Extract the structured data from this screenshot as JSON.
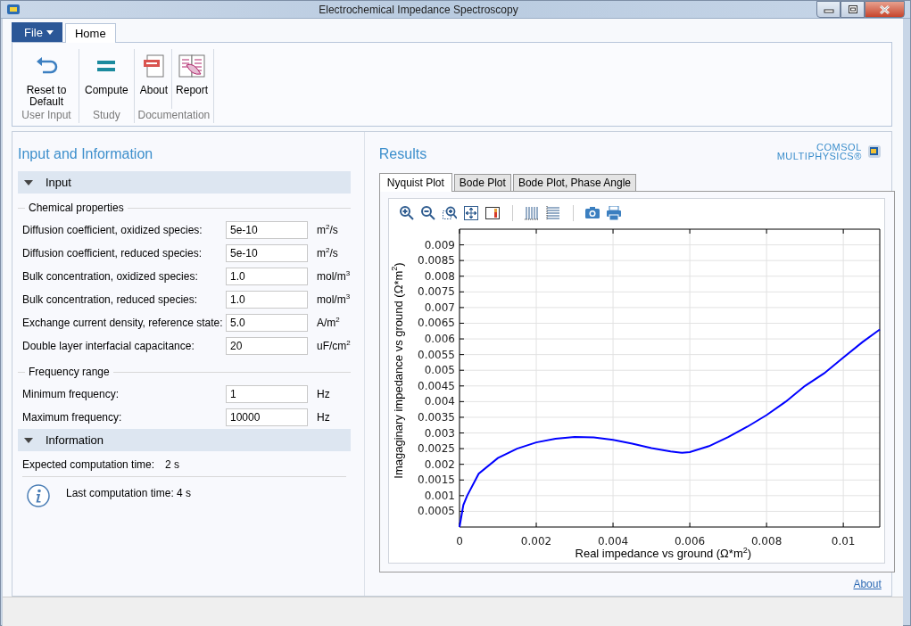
{
  "window": {
    "title": "Electrochemical Impedance Spectroscopy"
  },
  "ribbon": {
    "file_menu": "File",
    "tabs": [
      {
        "label": "Home",
        "selected": true
      }
    ],
    "groups": [
      {
        "label": "User Input",
        "buttons": [
          {
            "label": "Reset to Default",
            "kind": "reset"
          }
        ]
      },
      {
        "label": "Study",
        "buttons": [
          {
            "label": "Compute",
            "kind": "compute"
          }
        ]
      },
      {
        "label": "Documentation",
        "buttons": [
          {
            "label": "About",
            "kind": "pdf"
          },
          {
            "label": "Report",
            "kind": "report"
          }
        ]
      }
    ]
  },
  "input_panel": {
    "title": "Input and Information",
    "sections": [
      {
        "kind": "input",
        "title": "Input",
        "expanded": true,
        "groups": [
          {
            "title": "Chemical properties",
            "fields": [
              {
                "label": "Diffusion coefficient, oxidized species:",
                "value": "5e-10",
                "unit": "m$^{2}$/s"
              },
              {
                "label": "Diffusion coefficient, reduced species:",
                "value": "5e-10",
                "unit": "m$^{2}$/s"
              },
              {
                "label": "Bulk concentration, oxidized species:",
                "value": "1.0",
                "unit": "mol/m$^{3}$"
              },
              {
                "label": "Bulk concentration, reduced species:",
                "value": "1.0",
                "unit": "mol/m$^{3}$"
              },
              {
                "label": "Exchange current density, reference state:",
                "value": "5.0",
                "unit": "A/m$^{2}$"
              },
              {
                "label": "Double layer interfacial capacitance:",
                "value": "20",
                "unit": "uF/cm$^{2}$"
              }
            ]
          },
          {
            "title": "Frequency range",
            "fields": [
              {
                "label": "Minimum frequency:",
                "value": "1",
                "unit": "Hz"
              },
              {
                "label": "Maximum frequency:",
                "value": "10000",
                "unit": "Hz"
              }
            ]
          }
        ]
      },
      {
        "kind": "info",
        "title": "Information",
        "expanded": true,
        "expected_label": "Expected computation time:",
        "expected_value": "2 s",
        "message": "Last computation time: 4 s"
      }
    ]
  },
  "results": {
    "title": "Results",
    "logo": [
      "COMSOL",
      "MULTIPHYSICS®"
    ],
    "tabs": [
      {
        "label": "Nyquist Plot",
        "selected": true
      },
      {
        "label": "Bode Plot",
        "selected": false
      },
      {
        "label": "Bode Plot, Phase Angle",
        "selected": false
      }
    ],
    "chart_data": {
      "type": "line",
      "xlabel": "Real impedance vs ground (Ω*m$^{2}$)",
      "ylabel": "Imagaginary impedance vs ground (Ω*m$^{2}$)",
      "x": [
        0,
        0.0001,
        0.0002,
        0.0005,
        0.001,
        0.0015,
        0.002,
        0.0025,
        0.003,
        0.0035,
        0.004,
        0.0045,
        0.005,
        0.0055,
        0.0058,
        0.006,
        0.0065,
        0.007,
        0.0075,
        0.008,
        0.0085,
        0.009,
        0.0095,
        0.01,
        0.0105,
        0.01095
      ],
      "series": [
        {
          "color": "#0000ff",
          "values": [
            0,
            0.0007,
            0.001,
            0.0017,
            0.0022,
            0.0025,
            0.0027,
            0.00282,
            0.00287,
            0.00286,
            0.00278,
            0.00266,
            0.00252,
            0.00241,
            0.00237,
            0.00239,
            0.00258,
            0.00287,
            0.0032,
            0.00357,
            0.004,
            0.0045,
            0.0049,
            0.0054,
            0.0059,
            0.0063
          ]
        }
      ],
      "grid": true,
      "xlim": [
        0,
        0.01095
      ],
      "ylim": [
        0,
        0.0095
      ],
      "xticks": [
        0,
        0.002,
        0.004,
        0.006,
        0.008,
        0.01
      ],
      "yticks": [
        0.0005,
        0.001,
        0.0015,
        0.002,
        0.0025,
        0.003,
        0.0035,
        0.004,
        0.0045,
        0.005,
        0.0055,
        0.006,
        0.0065,
        0.007,
        0.0075,
        0.008,
        0.0085,
        0.009
      ]
    },
    "about_link": "About"
  }
}
